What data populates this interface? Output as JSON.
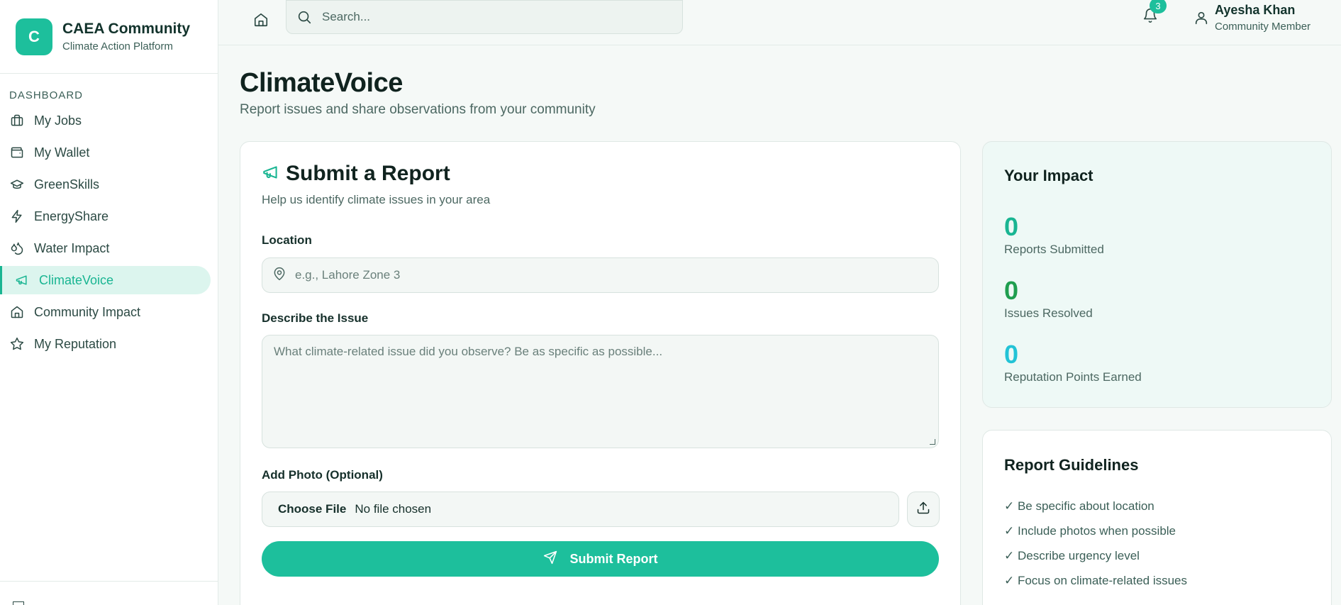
{
  "brand": {
    "logo_letter": "C",
    "name": "CAEA Community",
    "tagline": "Climate Action Platform"
  },
  "sidebar": {
    "section": "DASHBOARD",
    "items": [
      {
        "label": "My Jobs",
        "icon": "briefcase-icon"
      },
      {
        "label": "My Wallet",
        "icon": "wallet-icon"
      },
      {
        "label": "GreenSkills",
        "icon": "graduation-cap-icon"
      },
      {
        "label": "EnergyShare",
        "icon": "bolt-icon"
      },
      {
        "label": "Water Impact",
        "icon": "droplets-icon"
      },
      {
        "label": "ClimateVoice",
        "icon": "megaphone-icon",
        "active": true
      },
      {
        "label": "Community Impact",
        "icon": "home-icon"
      },
      {
        "label": "My Reputation",
        "icon": "star-icon"
      }
    ]
  },
  "topbar": {
    "search_placeholder": "Search...",
    "notification_count": "3",
    "user_name": "Ayesha Khan",
    "user_role": "Community Member"
  },
  "page": {
    "title": "ClimateVoice",
    "subtitle": "Report issues and share observations from your community"
  },
  "report_form": {
    "title": "Submit a Report",
    "subtitle": "Help us identify climate issues in your area",
    "location_label": "Location",
    "location_placeholder": "e.g., Lahore Zone 3",
    "issue_label": "Describe the Issue",
    "issue_placeholder": "What climate-related issue did you observe? Be as specific as possible...",
    "photo_label": "Add Photo (Optional)",
    "choose_file": "Choose File",
    "no_file": "No file chosen",
    "submit_label": "Submit Report"
  },
  "impact": {
    "title": "Your Impact",
    "stats": [
      {
        "value": "0",
        "label": "Reports Submitted",
        "color": "#19b592"
      },
      {
        "value": "0",
        "label": "Issues Resolved",
        "color": "#1f9e4f"
      },
      {
        "value": "0",
        "label": "Reputation Points Earned",
        "color": "#22c3d6"
      }
    ]
  },
  "guidelines": {
    "title": "Report Guidelines",
    "items": [
      "✓ Be specific about location",
      "✓ Include photos when possible",
      "✓ Describe urgency level",
      "✓ Focus on climate-related issues"
    ]
  },
  "colors": {
    "accent": "#1dbf9c",
    "active_bg": "#dcf5ee"
  }
}
